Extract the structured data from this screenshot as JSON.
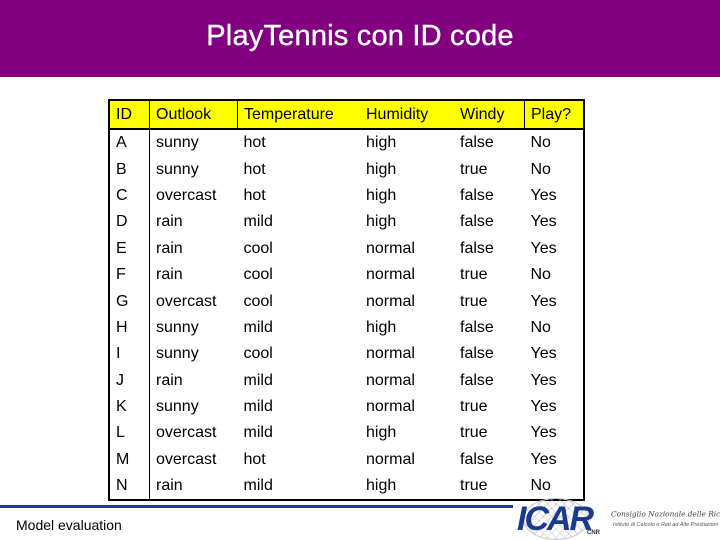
{
  "slide": {
    "title": "PlayTennis con ID code",
    "footer_text": "Model evaluation",
    "colors": {
      "title_bar": "#820080",
      "header_fill": "#ffff00",
      "footer_line": "#1f3a82"
    }
  },
  "table": {
    "columns": [
      "ID",
      "Outlook",
      "Temperature",
      "Humidity",
      "Windy",
      "Play?"
    ],
    "rows": [
      [
        "A",
        "sunny",
        "hot",
        "high",
        "false",
        "No"
      ],
      [
        "B",
        "sunny",
        "hot",
        "high",
        "true",
        "No"
      ],
      [
        "C",
        "overcast",
        "hot",
        "high",
        "false",
        "Yes"
      ],
      [
        "D",
        "rain",
        "mild",
        "high",
        "false",
        "Yes"
      ],
      [
        "E",
        "rain",
        "cool",
        "normal",
        "false",
        "Yes"
      ],
      [
        "F",
        "rain",
        "cool",
        "normal",
        "true",
        "No"
      ],
      [
        "G",
        "overcast",
        "cool",
        "normal",
        "true",
        "Yes"
      ],
      [
        "H",
        "sunny",
        "mild",
        "high",
        "false",
        "No"
      ],
      [
        "I",
        "sunny",
        "cool",
        "normal",
        "false",
        "Yes"
      ],
      [
        "J",
        "rain",
        "mild",
        "normal",
        "false",
        "Yes"
      ],
      [
        "K",
        "sunny",
        "mild",
        "normal",
        "true",
        "Yes"
      ],
      [
        "L",
        "overcast",
        "mild",
        "high",
        "true",
        "Yes"
      ],
      [
        "M",
        "overcast",
        "hot",
        "normal",
        "false",
        "Yes"
      ],
      [
        "N",
        "rain",
        "mild",
        "high",
        "true",
        "No"
      ]
    ]
  },
  "logo": {
    "mark": "ICAR",
    "cnr": "CNR",
    "org": "Consiglio Nazionale delle Ricerche",
    "sub": "Istituto di Calcolo e Reti ad Alte Prestazioni"
  }
}
